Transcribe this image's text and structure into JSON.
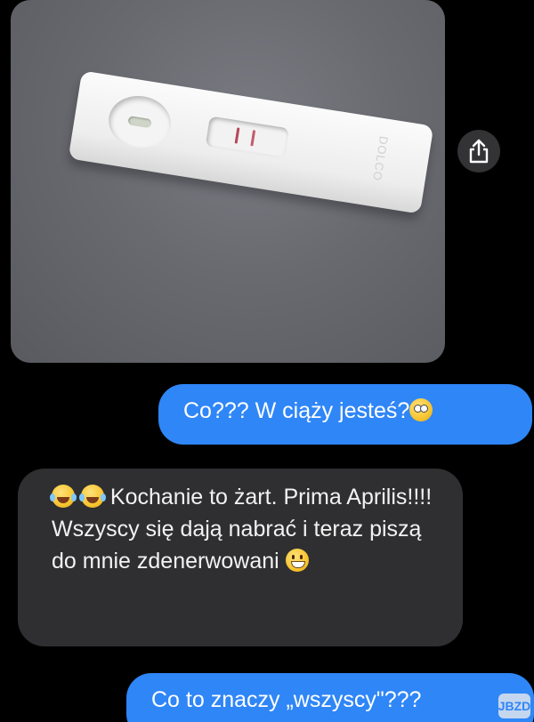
{
  "photo": {
    "strip_label": "DOLCO"
  },
  "messages": [
    {
      "direction": "sent",
      "text": "Co??? W ciąży jesteś?",
      "trailing_emoji": "flushed-face"
    },
    {
      "direction": "received",
      "leading_emoji": [
        "tears-of-joy",
        "tears-of-joy"
      ],
      "text": "Kochanie to żart. Prima Aprilis!!!! Wszyscy się dają nabrać i teraz piszą do mnie zdenerwowani",
      "trailing_emoji": "grinning-face"
    },
    {
      "direction": "sent",
      "text": "Co to znaczy „wszyscy\"???"
    }
  ],
  "share_icon": "share-icon",
  "watermark": "JBZD",
  "colors": {
    "sent_bubble": "#2f86f7",
    "received_bubble": "#2f2f31",
    "background": "#000000"
  }
}
